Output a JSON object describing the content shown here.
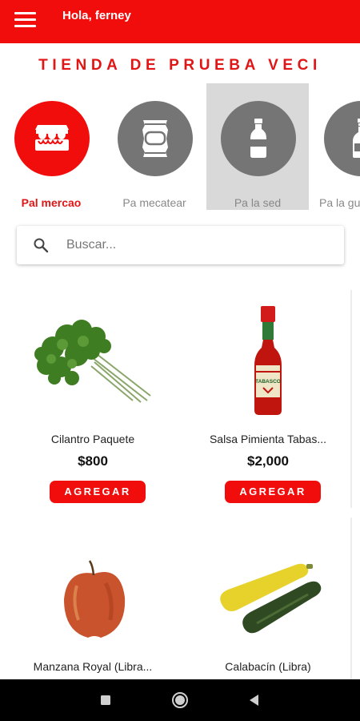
{
  "appbar": {
    "greeting": "Hola, ferney",
    "menu_icon": "hamburger-menu-icon"
  },
  "store": {
    "title": "TIENDA DE PRUEBA VECI"
  },
  "categories": [
    {
      "label": "Pal mercao",
      "icon": "egg-carton-icon",
      "active": true
    },
    {
      "label": "Pa mecatear",
      "icon": "snack-bag-icon",
      "active": false
    },
    {
      "label": "Pa la sed",
      "icon": "soda-bottle-icon",
      "active": false
    },
    {
      "label": "Pa la gu",
      "icon": "liquor-bottle-icon",
      "active": false
    }
  ],
  "search": {
    "placeholder": "Buscar..."
  },
  "add_label": "AGREGAR",
  "products": [
    {
      "name": "Cilantro Paquete",
      "price": "$800",
      "image": "cilantro"
    },
    {
      "name": "Salsa Pimienta Tabas...",
      "price": "$2,000",
      "image": "tabasco",
      "image_text": "TABASCO"
    },
    {
      "name": "Manzana Royal (Libra...",
      "price": "",
      "image": "apple"
    },
    {
      "name": "Calabacín (Libra)",
      "price": "",
      "image": "zucchini"
    }
  ],
  "colors": {
    "primary": "#f20d0d",
    "inactive_category": "#757575",
    "selected_category_bg": "#d9d9d9"
  }
}
